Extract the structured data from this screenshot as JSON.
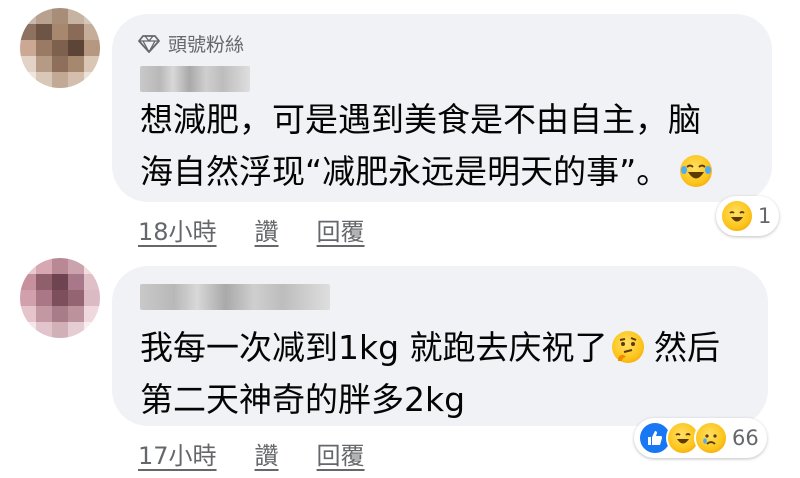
{
  "comments": [
    {
      "badge": "頭號粉絲",
      "text_lines": [
        "想減肥，可是遇到美食是不由自主，脑",
        "海自然浮现“减肥永远是明天的事”。"
      ],
      "time": "18小時",
      "like_label": "讚",
      "reply_label": "回覆",
      "reaction_count": "1",
      "reaction_icons": [
        "laugh-icon"
      ]
    },
    {
      "text_lines": [
        "我每一次减到1kg 就跑去庆祝了",
        " 然后",
        "第二天神奇的胖多2kg"
      ],
      "time": "17小時",
      "like_label": "讚",
      "reply_label": "回覆",
      "reaction_count": "66",
      "reaction_icons": [
        "like-icon",
        "laugh-icon",
        "sad-icon"
      ]
    }
  ],
  "colors": {
    "bubble": "#f0f2f5",
    "meta_text": "#65676b",
    "body_text": "#050505",
    "like_blue": "#1877f2"
  }
}
